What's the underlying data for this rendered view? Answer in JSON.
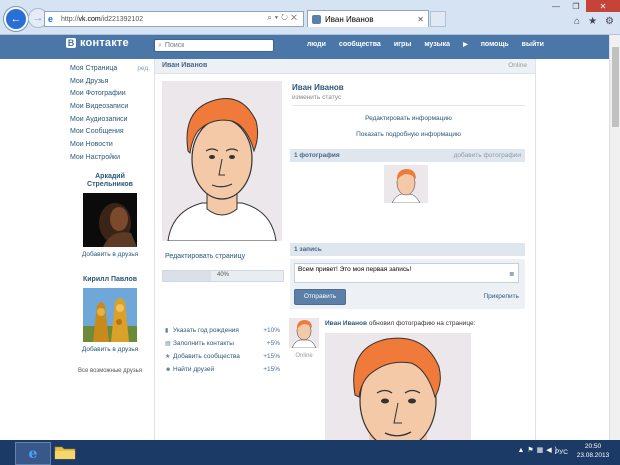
{
  "browser": {
    "url_proto": "http://",
    "url_host": "vk.com",
    "url_path": "/id221392102",
    "tab_title": "Иван Иванов"
  },
  "vk": {
    "logo_letter": "В",
    "logo_text": "контакте",
    "search_placeholder": "Поиск",
    "topnav": [
      "люди",
      "сообщества",
      "игры",
      "музыка",
      "помощь",
      "выйти"
    ]
  },
  "leftmenu": {
    "edit_label": "ред.",
    "items": [
      "Моя Страница",
      "Мои Друзья",
      "Мои Фотографии",
      "Мои Видеозаписи",
      "Мои Аудиозаписи",
      "Мои Сообщения",
      "Мои Новости",
      "Мои Настройки"
    ]
  },
  "friends": [
    {
      "name_line1": "Аркадий",
      "name_line2": "Стрельников",
      "add_label": "Добавить в друзья"
    },
    {
      "name_line1": "Кирилл Павлов",
      "name_line2": "",
      "add_label": "Добавить в друзья"
    }
  ],
  "all_friends_label": "Все возможные друзья",
  "profile": {
    "header_name": "Иван Иванов",
    "online": "Online",
    "name": "Иван Иванов",
    "status_placeholder": "изменить статус",
    "edit_info": "Редактировать информацию",
    "show_info": "Показать подробную информацию",
    "edit_page": "Редактировать страницу",
    "progress_label": "40%",
    "progress_value": 0.4
  },
  "tasks": [
    {
      "icon": "chart-icon",
      "label": "Указать год рождения",
      "pct": "+10%"
    },
    {
      "icon": "doc-icon",
      "label": "Заполнить контакты",
      "pct": "+5%"
    },
    {
      "icon": "star-icon",
      "label": "Добавить сообщества",
      "pct": "+15%"
    },
    {
      "icon": "people-icon",
      "label": "Найти друзей",
      "pct": "+15%"
    }
  ],
  "photos_section": {
    "title": "1 фотография",
    "action": "добавить фотографии"
  },
  "wall": {
    "title": "1 запись",
    "input_value": "Всем привет! Это моя первая запись!",
    "send_label": "Отправить",
    "attach_label": "Прикрепить"
  },
  "post": {
    "author": "Иван Иванов",
    "text": "обновил фотографию на странице:",
    "online": "Online"
  },
  "taskbar": {
    "lang": "РУС",
    "time": "20:50",
    "date": "23.08.2013"
  },
  "colors": {
    "vk_blue": "#4a76a8",
    "link": "#2b587a",
    "taskbar": "#1c3a66"
  }
}
